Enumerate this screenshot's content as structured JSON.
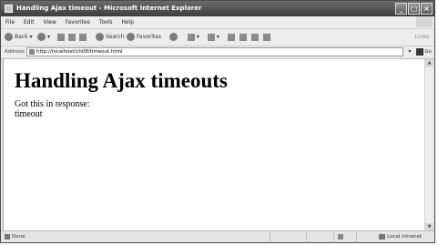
{
  "window": {
    "title": "Handling Ajax timeout - Microsoft Internet Explorer"
  },
  "menubar": {
    "items": [
      "File",
      "Edit",
      "View",
      "Favorites",
      "Tools",
      "Help"
    ]
  },
  "toolbar": {
    "back_label": "Back",
    "search_label": "Search",
    "favorites_label": "Favorites",
    "links_label": "Links"
  },
  "addressbar": {
    "label": "Address",
    "url": "http://localhost/ch08/timeout.html",
    "go_label": "Go"
  },
  "page": {
    "heading": "Handling Ajax timeouts",
    "line1": "Got this in response:",
    "line2": "timeout"
  },
  "statusbar": {
    "status": "Done",
    "zone": "Local intranet"
  }
}
